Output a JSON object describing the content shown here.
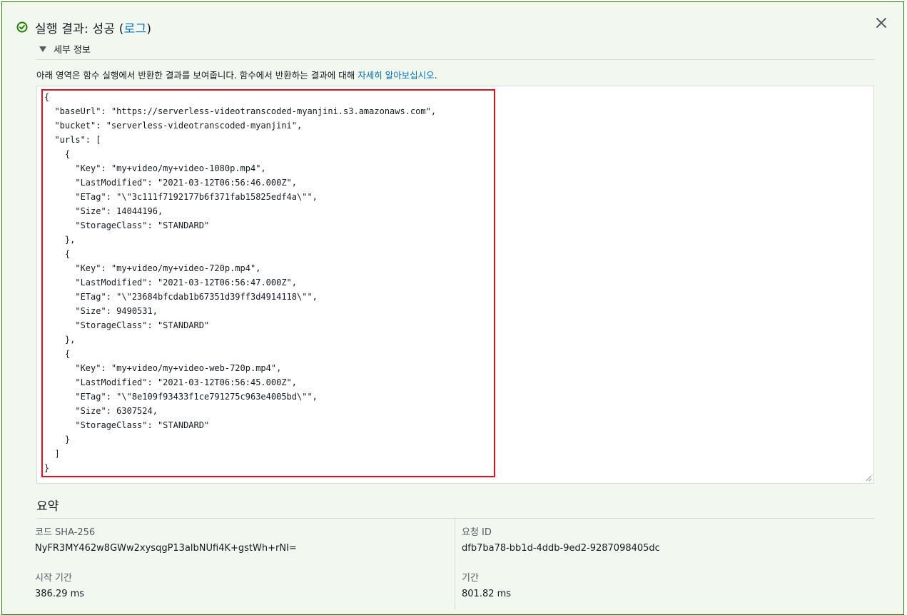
{
  "result": {
    "title_prefix": "실행 결과: 성공 (",
    "log_link": "로그",
    "title_suffix": ")",
    "details_label": "세부 정보",
    "description": "아래 영역은 함수 실행에서 반환한 결과를 보여줍니다. 함수에서 반환하는 결과에 대해 ",
    "learn_more_link": "자세히 알아보십시오",
    "description_end": ".",
    "json_output": "{\n  \"baseUrl\": \"https://serverless-videotranscoded-myanjini.s3.amazonaws.com\",\n  \"bucket\": \"serverless-videotranscoded-myanjini\",\n  \"urls\": [\n    {\n      \"Key\": \"my+video/my+video-1080p.mp4\",\n      \"LastModified\": \"2021-03-12T06:56:46.000Z\",\n      \"ETag\": \"\\\"3c111f7192177b6f371fab15825edf4a\\\"\",\n      \"Size\": 14044196,\n      \"StorageClass\": \"STANDARD\"\n    },\n    {\n      \"Key\": \"my+video/my+video-720p.mp4\",\n      \"LastModified\": \"2021-03-12T06:56:47.000Z\",\n      \"ETag\": \"\\\"23684bfcdab1b67351d39ff3d4914118\\\"\",\n      \"Size\": 9490531,\n      \"StorageClass\": \"STANDARD\"\n    },\n    {\n      \"Key\": \"my+video/my+video-web-720p.mp4\",\n      \"LastModified\": \"2021-03-12T06:56:45.000Z\",\n      \"ETag\": \"\\\"8e109f93433f1ce791275c963e4005bd\\\"\",\n      \"Size\": 6307524,\n      \"StorageClass\": \"STANDARD\"\n    }\n  ]\n}"
  },
  "summary": {
    "title": "요약",
    "code_sha_label": "코드 SHA-256",
    "code_sha_value": "NyFR3MY462w8GWw2xysqgP13albNUfi4K+gstWh+rNI=",
    "request_id_label": "요청 ID",
    "request_id_value": "dfb7ba78-bb1d-4ddb-9ed2-9287098405dc",
    "init_duration_label": "시작 기간",
    "init_duration_value": "386.29 ms",
    "duration_label": "기간",
    "duration_value": "801.82 ms"
  },
  "colors": {
    "success": "#1d8102",
    "link": "#0073bb",
    "highlight": "#e0101e",
    "panel_bg": "#f2f8f0"
  },
  "icons": {
    "status": "success-check-icon",
    "close": "close-icon",
    "toggle": "caret-down-icon"
  }
}
